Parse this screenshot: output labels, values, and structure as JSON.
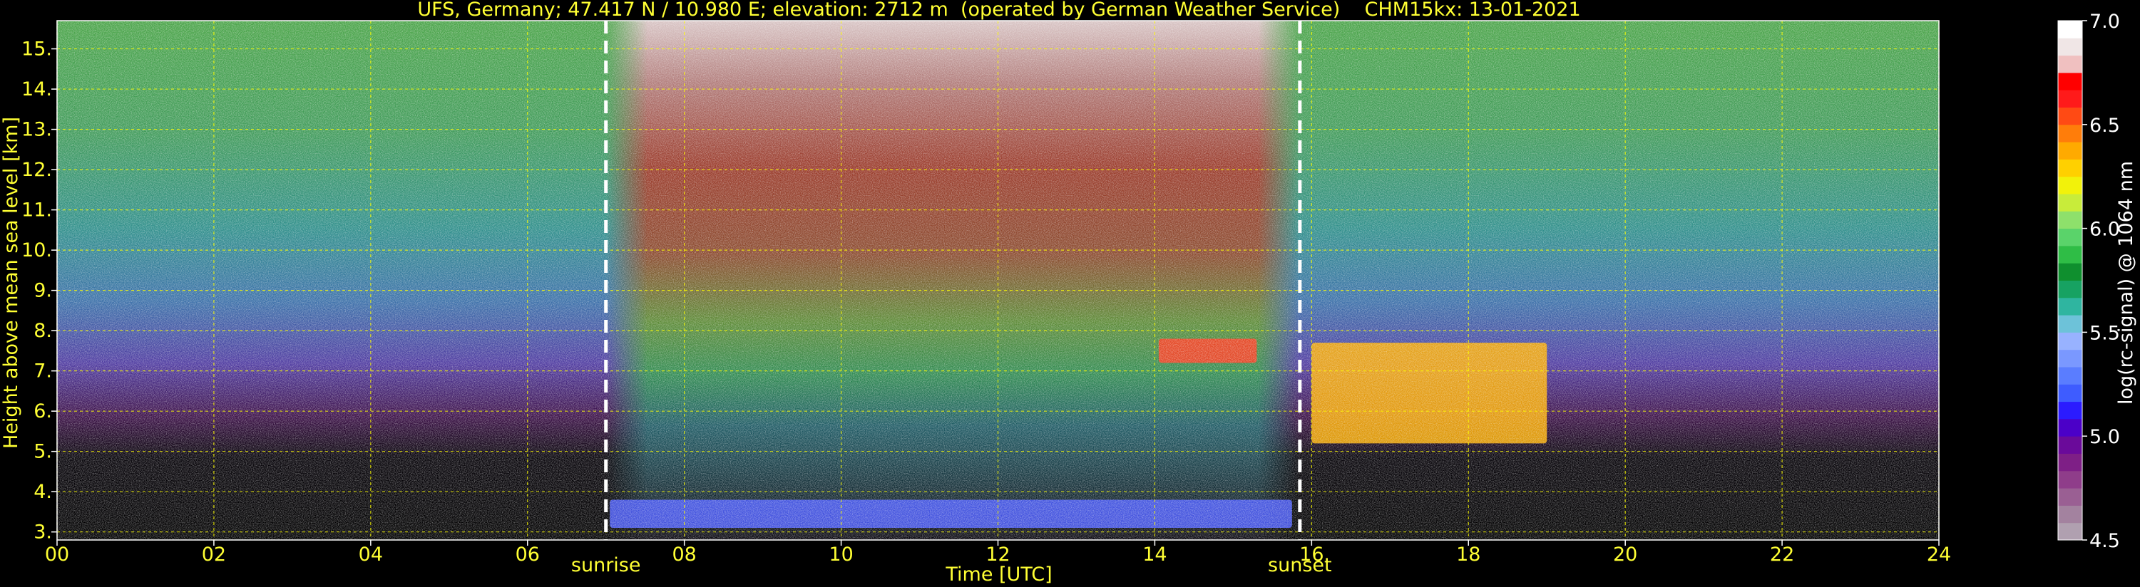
{
  "chart_data": [
    {
      "type": "heatmap",
      "title": "UFS, Germany; 47.417 N / 10.980 E; elevation: 2712 m  (operated by German Weather Service)    CHM15kx: 13-01-2021",
      "xlabel": "Time [UTC]",
      "ylabel": "Height above mean sea level [km]",
      "xlim": [
        0,
        24
      ],
      "ylim": [
        2.8,
        15.7
      ],
      "x_ticks": [
        "00",
        "02",
        "04",
        "06",
        "08",
        "10",
        "12",
        "14",
        "16",
        "18",
        "20",
        "22",
        "24"
      ],
      "x_tick_values": [
        0,
        2,
        4,
        6,
        8,
        10,
        12,
        14,
        16,
        18,
        20,
        22,
        24
      ],
      "y_ticks": [
        "3.",
        "4.",
        "5.",
        "6.",
        "7.",
        "8.",
        "9.",
        "10.",
        "11.",
        "12.",
        "13.",
        "14.",
        "15."
      ],
      "y_tick_values": [
        3,
        4,
        5,
        6,
        7,
        8,
        9,
        10,
        11,
        12,
        13,
        14,
        15
      ],
      "grid": true,
      "events": [
        {
          "label": "sunrise",
          "x": 7.0
        },
        {
          "label": "sunset",
          "x": 15.85
        }
      ],
      "signal_regions": [
        {
          "x0": 7.05,
          "x1": 15.75,
          "y0": 3.1,
          "y1": 3.8,
          "color": "#4a5cff"
        },
        {
          "x0": 14.05,
          "x1": 15.3,
          "y0": 7.2,
          "y1": 7.8,
          "color": "#ff3a1e"
        },
        {
          "x0": 16.0,
          "x1": 19.0,
          "y0": 5.2,
          "y1": 7.7,
          "color": "#ffb000"
        }
      ]
    },
    {
      "type": "heatmap",
      "role": "colorbar",
      "label": "log(rc-signal) @ 1064 nm",
      "range": [
        4.5,
        7.0
      ],
      "ticks": [
        "4.5",
        "5.0",
        "5.5",
        "6.0",
        "6.5",
        "7.0"
      ],
      "tick_values": [
        4.5,
        5.0,
        5.5,
        6.0,
        6.5,
        7.0
      ],
      "colors": [
        "#b0a0b0",
        "#a3829f",
        "#9a5f93",
        "#8f3d8a",
        "#7e1f86",
        "#6a0a9a",
        "#4b00c8",
        "#2b1bff",
        "#3e5cff",
        "#5a7dff",
        "#7a98ff",
        "#98b2ff",
        "#6dc2d9",
        "#2fb5a0",
        "#17a262",
        "#0f8f2e",
        "#2fbd46",
        "#5ad36a",
        "#8ee06b",
        "#c8ec3a",
        "#f2f20a",
        "#ffd000",
        "#ffaa00",
        "#ff7d0a",
        "#ff4a14",
        "#ff1a1a",
        "#ff0000",
        "#f0c0c0",
        "#f0e6e6",
        "#ffffff"
      ]
    }
  ]
}
